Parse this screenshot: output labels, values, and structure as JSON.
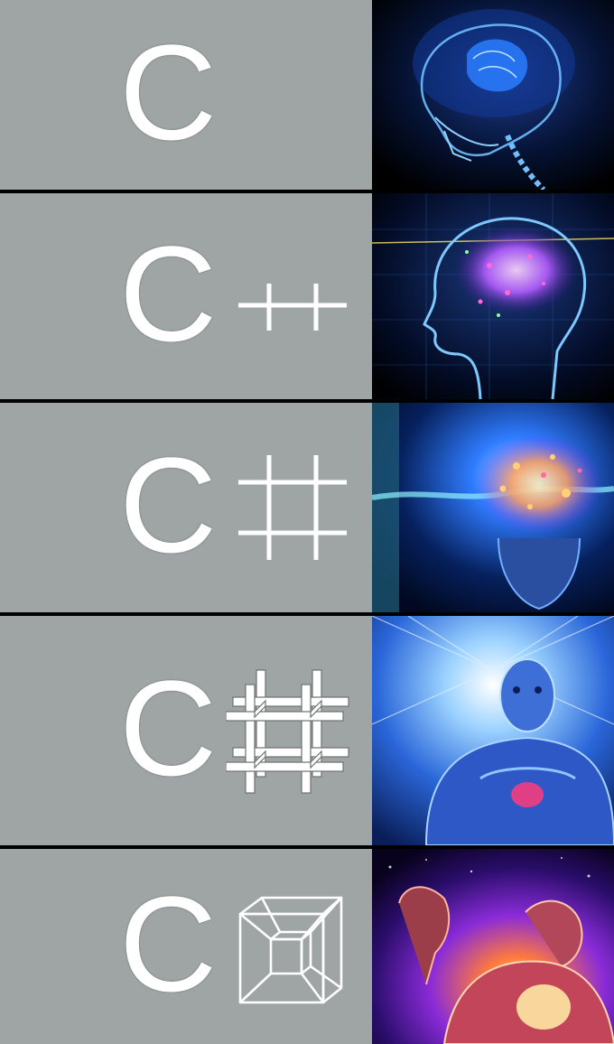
{
  "panels": [
    {
      "base_letter": "C",
      "suffix_icon": "none",
      "art": "glowing-skull-brain-image",
      "colors": [
        "#0a1a4a",
        "#2f6cff",
        "#8ed2ff"
      ]
    },
    {
      "base_letter": "C",
      "suffix_icon": "plus-plus-icon",
      "art": "circuit-brain-head-image",
      "colors": [
        "#071738",
        "#39a7ff",
        "#d66cff"
      ]
    },
    {
      "base_letter": "C",
      "suffix_icon": "sharp-icon",
      "art": "cosmic-mind-image",
      "colors": [
        "#061c59",
        "#3aa8ff",
        "#ffdb7a"
      ]
    },
    {
      "base_letter": "C",
      "suffix_icon": "3d-sharp-grid-icon",
      "art": "enlightened-figure-image",
      "colors": [
        "#0b2a6b",
        "#4f9bff",
        "#e8f6ff"
      ]
    },
    {
      "base_letter": "C",
      "suffix_icon": "tesseract-icon",
      "art": "galaxy-being-image",
      "colors": [
        "#160531",
        "#8b2bff",
        "#ffb347"
      ]
    }
  ]
}
